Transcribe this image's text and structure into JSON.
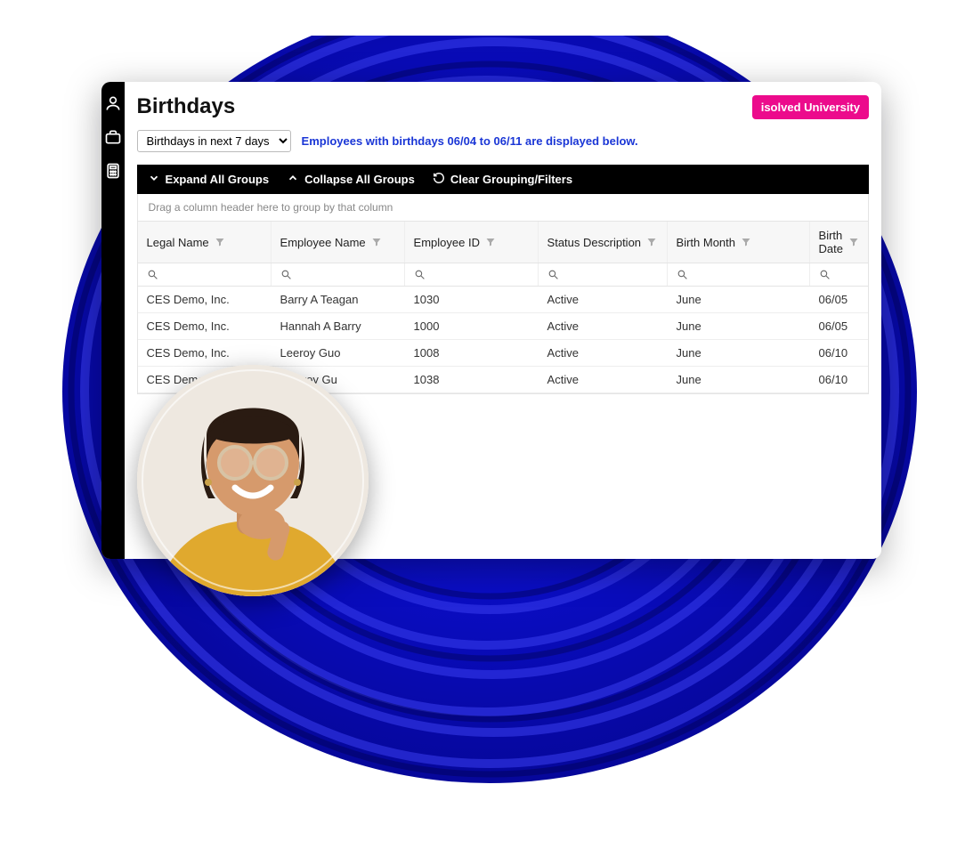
{
  "header": {
    "title": "Birthdays",
    "university_button": "isolved University"
  },
  "controls": {
    "range_select_value": "Birthdays in next 7 days",
    "info_text": "Employees with birthdays 06/04 to 06/11 are displayed below."
  },
  "toolbar": {
    "expand_label": "Expand All Groups",
    "collapse_label": "Collapse All Groups",
    "clear_label": "Clear Grouping/Filters"
  },
  "grid": {
    "group_hint": "Drag a column header here to group by that column",
    "columns": [
      "Legal Name",
      "Employee Name",
      "Employee ID",
      "Status Description",
      "Birth Month",
      "Birth Date"
    ],
    "rows": [
      {
        "legal_name": "CES Demo, Inc.",
        "employee_name": "Barry A Teagan",
        "employee_id": "1030",
        "status": "Active",
        "birth_month": "June",
        "birth_date": "06/05"
      },
      {
        "legal_name": "CES Demo, Inc.",
        "employee_name": "Hannah A Barry",
        "employee_id": "1000",
        "status": "Active",
        "birth_month": "June",
        "birth_date": "06/05"
      },
      {
        "legal_name": "CES Demo, Inc.",
        "employee_name": "Leeroy Guo",
        "employee_id": "1008",
        "status": "Active",
        "birth_month": "June",
        "birth_date": "06/10"
      },
      {
        "legal_name": "CES Demo, Inc.",
        "employee_name": "Sauvoy Gu",
        "employee_id": "1038",
        "status": "Active",
        "birth_month": "June",
        "birth_date": "06/10"
      }
    ]
  },
  "sidebar": {
    "icons": [
      "person-icon",
      "briefcase-icon",
      "calculator-icon"
    ]
  }
}
